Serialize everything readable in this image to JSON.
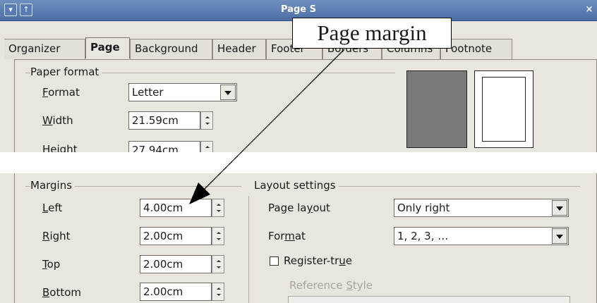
{
  "window": {
    "title": "Page S",
    "close_glyph": "×",
    "btn_down_glyph": "▾",
    "btn_up_glyph": "↑"
  },
  "tabs": [
    "Organizer",
    "Page",
    "Background",
    "Header",
    "Footer",
    "Borders",
    "Columns",
    "Footnote"
  ],
  "active_tab": "Page",
  "paper_format": {
    "group_label": "Paper format",
    "format": {
      "label_underline": "F",
      "label_rest": "ormat",
      "value": "Letter"
    },
    "width": {
      "label_underline": "W",
      "label_rest": "idth",
      "value": "21.59cm"
    },
    "height": {
      "label": "Height",
      "value": "27.94cm"
    }
  },
  "margins": {
    "group_label": "Margins",
    "left": {
      "label_underline": "L",
      "label_rest": "eft",
      "value": "4.00cm"
    },
    "right": {
      "label_underline": "R",
      "label_rest": "ight",
      "value": "2.00cm"
    },
    "top": {
      "label_underline": "T",
      "label_rest": "op",
      "value": "2.00cm"
    },
    "bottom": {
      "label_underline": "B",
      "label_rest": "ottom",
      "value": "2.00cm"
    }
  },
  "layout_settings": {
    "group_label": "Layout settings",
    "page_layout": {
      "label_pre": "Page la",
      "label_underline": "y",
      "label_post": "out",
      "value": "Only right"
    },
    "format": {
      "label_pre": "For",
      "label_underline": "m",
      "label_post": "at",
      "value": "1, 2, 3, …"
    },
    "register_true": {
      "label_pre": "Register-tr",
      "label_underline": "u",
      "label_post": "e",
      "checked": false
    },
    "reference_style": {
      "label_pre": "Reference ",
      "label_underline": "S",
      "label_post": "tyle"
    }
  },
  "annotation": {
    "text": "Page margin"
  },
  "colors": {
    "titlebar": "#5a7cb4",
    "dialog_bg": "#e9e6e0",
    "preview_dark": "#7a7a7a"
  }
}
